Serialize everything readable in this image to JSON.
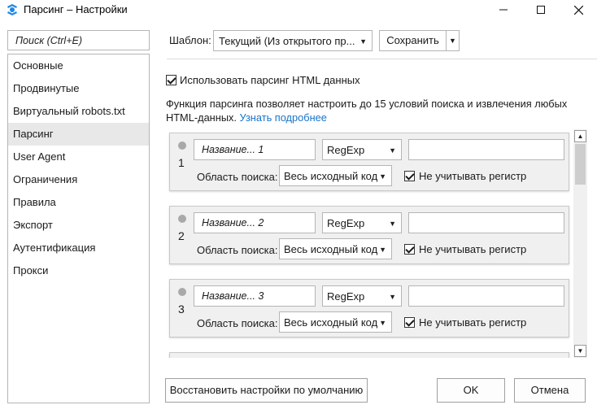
{
  "window": {
    "title": "Парсинг – Настройки"
  },
  "sidebar": {
    "search_placeholder": "Поиск (Ctrl+E)",
    "items": [
      "Основные",
      "Продвинутые",
      "Виртуальный robots.txt",
      "Парсинг",
      "User Agent",
      "Ограничения",
      "Правила",
      "Экспорт",
      "Аутентификация",
      "Прокси"
    ],
    "active": "Парсинг"
  },
  "template": {
    "label": "Шаблон:",
    "value": "Текущий (Из открытого пр...",
    "save_label": "Сохранить"
  },
  "parsing": {
    "enable_label": "Использовать парсинг HTML данных",
    "description": "Функция парсинга позволяет настроить до 15 условий поиска и извлечения любых HTML-данных. ",
    "learn_more": "Узнать подробнее"
  },
  "rules": [
    {
      "number": "1",
      "name": "Название... 1",
      "type": "RegExp",
      "value": "",
      "area_label": "Область поиска:",
      "area": "Весь исходный код",
      "case_label": "Не учитывать регистр"
    },
    {
      "number": "2",
      "name": "Название... 2",
      "type": "RegExp",
      "value": "",
      "area_label": "Область поиска:",
      "area": "Весь исходный код",
      "case_label": "Не учитывать регистр"
    },
    {
      "number": "3",
      "name": "Название... 3",
      "type": "RegExp",
      "value": "",
      "area_label": "Область поиска:",
      "area": "Весь исходный код",
      "case_label": "Не учитывать регистр"
    }
  ],
  "buttons": {
    "reset": "Восстановить настройки по умолчанию",
    "ok": "OK",
    "cancel": "Отмена"
  },
  "colors": {
    "link": "#1a73c8",
    "active_nav": "#e8e8e8",
    "panel_bg": "#f0f0f0"
  }
}
